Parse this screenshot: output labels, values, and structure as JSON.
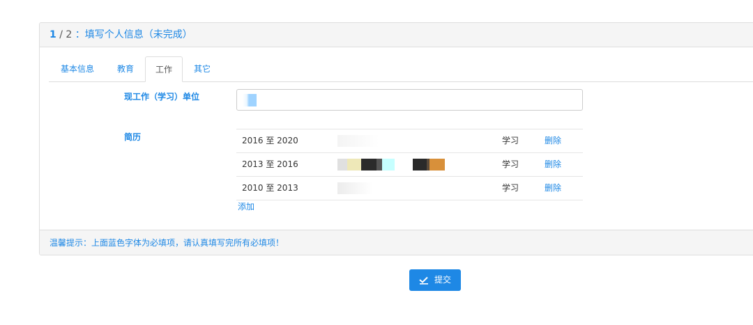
{
  "header": {
    "step_current": "1",
    "step_sep": "/",
    "step_total": "2",
    "step_title": "：填写个人信息（未完成）"
  },
  "tabs": [
    {
      "label": "基本信息",
      "active": false
    },
    {
      "label": "教育",
      "active": false
    },
    {
      "label": "工作",
      "active": true
    },
    {
      "label": "其它",
      "active": false
    }
  ],
  "form": {
    "current_unit_label": "现工作（学习）单位",
    "current_unit_value": "",
    "resume_label": "简历"
  },
  "resume": [
    {
      "period": "2016 至 2020",
      "type": "学习",
      "delete": "删除"
    },
    {
      "period": "2013 至 2016",
      "type": "学习",
      "delete": "删除"
    },
    {
      "period": "2010 至 2013",
      "type": "学习",
      "delete": "删除"
    }
  ],
  "add_label": "添加",
  "footer": {
    "tip": "温馨提示：上面蓝色字体为必填项，请认真填写完所有必填项！"
  },
  "submit": {
    "label": "提交",
    "icon": "check-icon"
  },
  "colors": {
    "accent": "#1e88e5",
    "panel_bg": "#f5f5f5",
    "border": "#dddddd"
  }
}
